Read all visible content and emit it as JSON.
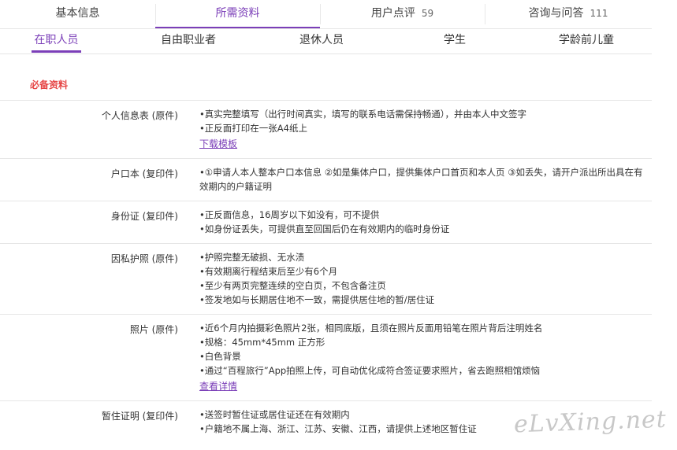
{
  "tabs": [
    {
      "label": "基本信息",
      "count": ""
    },
    {
      "label": "所需资料",
      "count": ""
    },
    {
      "label": "用户点评",
      "count": "59"
    },
    {
      "label": "咨询与问答",
      "count": "111"
    }
  ],
  "subtabs": [
    "在职人员",
    "自由职业者",
    "退休人员",
    "学生",
    "学龄前儿童"
  ],
  "section_title": "必备资料",
  "rows": [
    {
      "label": "个人信息表 (原件)",
      "items": [
        "•真实完整填写（出行时间真实，填写的联系电话需保持畅通），并由本人中文签字",
        "•正反面打印在一张A4纸上"
      ],
      "link": "下载模板"
    },
    {
      "label": "户口本 (复印件)",
      "items": [
        "•①申请人本人整本户口本信息 ②如是集体户口，提供集体户口首页和本人页 ③如丢失，请开户派出所出具在有效期内的户籍证明"
      ],
      "link": ""
    },
    {
      "label": "身份证 (复印件)",
      "items": [
        "•正反面信息，16周岁以下如没有，可不提供",
        "•如身份证丢失，可提供直至回国后仍在有效期内的临时身份证"
      ],
      "link": ""
    },
    {
      "label": "因私护照 (原件)",
      "items": [
        "•护照完整无破损、无水渍",
        "•有效期离行程结束后至少有6个月",
        "•至少有两页完整连续的空白页，不包含备注页",
        "•签发地如与长期居住地不一致，需提供居住地的暂/居住证"
      ],
      "link": ""
    },
    {
      "label": "照片 (原件)",
      "items": [
        "•近6个月内拍摄彩色照片2张，相同底版，且须在照片反面用铅笔在照片背后注明姓名",
        "•规格：45mm*45mm 正方形",
        "•白色背景",
        "•通过“百程旅行”App拍照上传，可自动优化成符合签证要求照片，省去跑照相馆烦恼"
      ],
      "link": "查看详情"
    },
    {
      "label": "暂住证明 (复印件)",
      "items": [
        "•送签时暂住证或居住证还在有效期内",
        "•户籍地不属上海、浙江、江苏、安徽、江西，请提供上述地区暂住证"
      ],
      "link": ""
    }
  ],
  "watermark": "eLvXing.net",
  "colors": {
    "accent": "#7b3fb8",
    "section_title": "#e64545",
    "divider": "#e6e6e6"
  }
}
